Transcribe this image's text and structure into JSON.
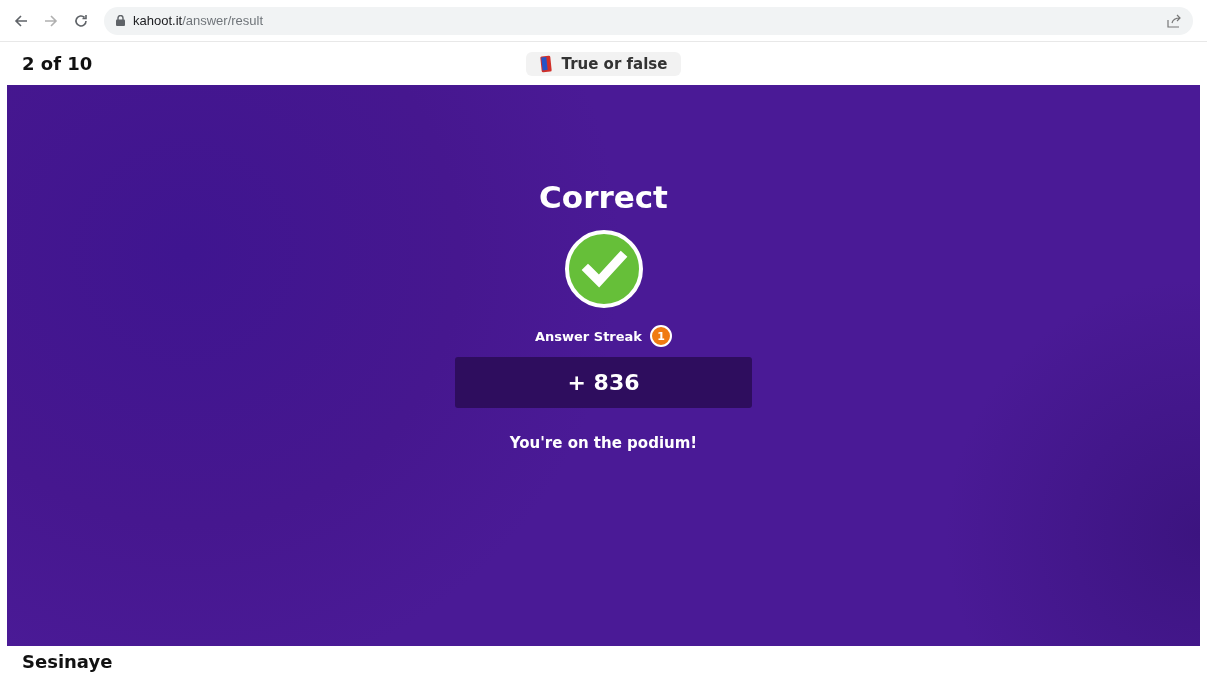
{
  "browser": {
    "url_host": "kahoot.it",
    "url_path": "/answer/result"
  },
  "header": {
    "progress": "2 of 10",
    "question_type": "True or false"
  },
  "result": {
    "title": "Correct",
    "correct": true,
    "streak_label": "Answer Streak",
    "streak_count": "1",
    "points": "+ 836",
    "message": "You're on the podium!"
  },
  "footer": {
    "player_name": "Sesinaye"
  }
}
